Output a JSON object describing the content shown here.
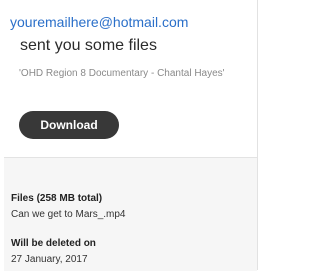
{
  "header": {
    "sender_email": "youremailhere@hotmail.com",
    "message": "sent you some files"
  },
  "transfer": {
    "title": "'OHD Region 8 Documentary - Chantal Hayes'"
  },
  "actions": {
    "download_label": "Download"
  },
  "files": {
    "heading": "Files (258 MB total)",
    "items": [
      "Can we get to Mars_.mp4"
    ]
  },
  "expiry": {
    "heading": "Will be deleted on",
    "date": "27 January, 2017"
  },
  "colors": {
    "link": "#2a6fc9",
    "button_bg": "#383838",
    "panel_bg": "#f6f6f6"
  }
}
